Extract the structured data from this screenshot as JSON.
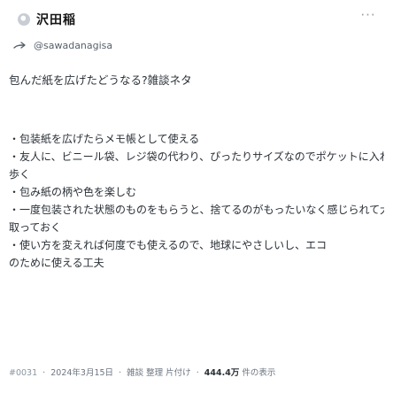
{
  "post": {
    "display_name": "沢田稲",
    "handle": "@sawadanagisa",
    "more_icon": "ellipsis-icon",
    "title": "包んだ紙を広げたどうなる?雑談ネタ",
    "lines": [
      "・包装紙を広げたらメモ帳として使える",
      "・友人に、ビニール袋、レジ袋の代わり、ぴったりサイズなのでポケットに入れて持ち",
      "歩く",
      "・包み紙の柄や色を楽しむ",
      "・一度包装された状態のものをもらうと、捨てるのがもったいなく感じられて大事に",
      "取っておく",
      "・使い方を変えれば何度でも使えるので、地球にやさしいし、エコ",
      "のために使える工夫"
    ],
    "meta": {
      "post_number": "#0031",
      "date": "2024年3月15日",
      "tags": "雑談 整理 片付け",
      "views": "444.4万",
      "views_label": "件の表示"
    }
  },
  "colors": {
    "text": "#2a3037",
    "muted": "#6d7580",
    "accent": "#8a96a3"
  }
}
